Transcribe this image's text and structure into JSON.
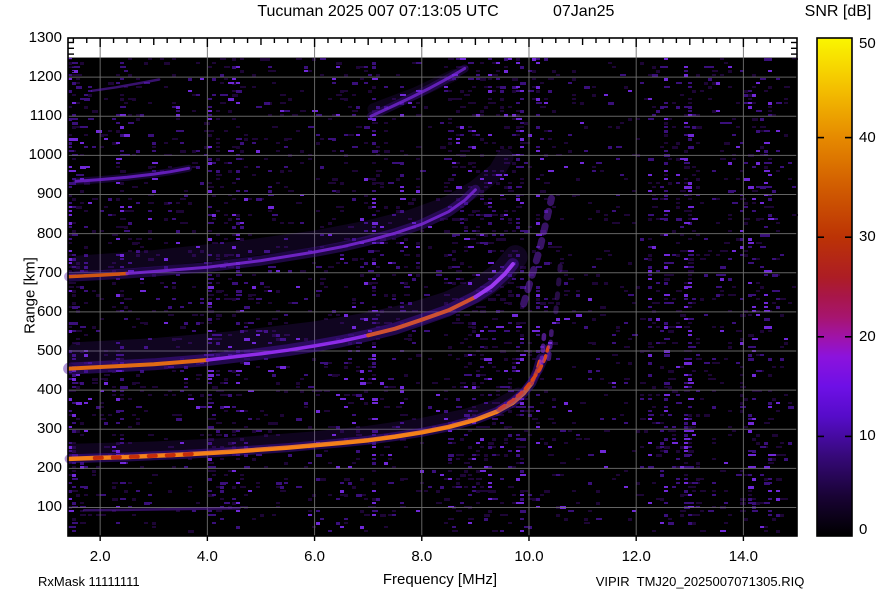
{
  "header": {
    "title_left": "Tucuman 2025 007 07:13:05 UTC",
    "title_right": "07Jan25",
    "colorbar_title": "SNR [dB]"
  },
  "footer": {
    "left": "RxMask 11111111",
    "right": "VIPIR  TMJ20_2025007071305.RIQ"
  },
  "axes": {
    "x": {
      "label": "Frequency [MHz]",
      "range_mhz": [
        1.4,
        15.0
      ],
      "tick_values": [
        2,
        4,
        6,
        8,
        10,
        12,
        14
      ],
      "tick_labels": [
        "2.0",
        "4.0",
        "6.0",
        "8.0",
        "10.0",
        "12.0",
        "14.0"
      ],
      "minor_step_mhz": 0.25
    },
    "y": {
      "label": "Range [km]",
      "range_km": [
        27,
        1300
      ],
      "tick_values": [
        100,
        200,
        300,
        400,
        500,
        600,
        700,
        800,
        900,
        1000,
        1100,
        1200,
        1300
      ],
      "tick_labels": [
        "100",
        "200",
        "300",
        "400",
        "500",
        "600",
        "700",
        "800",
        "900",
        "1000",
        "1100",
        "1200",
        "1300"
      ]
    },
    "colorbar": {
      "label": "SNR [dB]",
      "range_db": [
        0,
        50
      ],
      "tick_values": [
        0,
        10,
        20,
        30,
        40,
        50
      ],
      "tick_labels": [
        "0",
        "10",
        "20",
        "30",
        "40",
        "50"
      ],
      "gradient": [
        [
          0,
          "#000000"
        ],
        [
          0.08,
          "#190335"
        ],
        [
          0.16,
          "#360979"
        ],
        [
          0.24,
          "#560cc9"
        ],
        [
          0.3,
          "#6e10e6"
        ],
        [
          0.36,
          "#8c13dd"
        ],
        [
          0.4,
          "#a013a8"
        ],
        [
          0.44,
          "#a7156e"
        ],
        [
          0.48,
          "#a8164a"
        ],
        [
          0.52,
          "#ad1d24"
        ],
        [
          0.6,
          "#bc3305"
        ],
        [
          0.7,
          "#d15c01"
        ],
        [
          0.8,
          "#e68a00"
        ],
        [
          0.9,
          "#f4c000"
        ],
        [
          1.0,
          "#faf600"
        ]
      ]
    }
  },
  "chart_data": {
    "type": "heatmap",
    "title": "Tucuman ionogram 2025 day 007 07:13:05 UTC",
    "xlabel": "Frequency [MHz]",
    "ylabel": "Range [km]",
    "xlim_mhz": [
      1.4,
      15.0
    ],
    "ylim_km": [
      27,
      1300
    ],
    "snr_scale_db": [
      0,
      50
    ],
    "data_max_range_km": 1250,
    "grid": {
      "color": "#6f6f6f",
      "x_every_mhz": 2,
      "y_every_km": 100
    },
    "background_color": "#000000",
    "noise_speckle": {
      "base_density": 0.11,
      "colors": {
        "dim": "#220640",
        "mid": "#42118c",
        "bright": "#7c2cf0"
      },
      "low_range_sparse_below_km": 78
    },
    "rfi_stripes": [
      {
        "f": 1.48,
        "hw": 0.08,
        "boost": 5.0
      },
      {
        "f": 2.38,
        "hw": 0.05,
        "boost": 3.0
      },
      {
        "f": 4.06,
        "hw": 0.06,
        "boost": 5.0
      },
      {
        "f": 4.55,
        "hw": 0.05,
        "boost": 3.0
      },
      {
        "f": 7.12,
        "hw": 0.06,
        "boost": 5.0
      },
      {
        "f": 7.6,
        "hw": 0.04,
        "boost": 2.5
      },
      {
        "f": 9.25,
        "hw": 0.05,
        "boost": 3.0
      },
      {
        "f": 9.85,
        "hw": 0.06,
        "boost": 3.5
      },
      {
        "f": 10.15,
        "hw": 0.05,
        "boost": 3.0
      },
      {
        "f": 12.25,
        "hw": 0.04,
        "boost": 2.5
      },
      {
        "f": 12.55,
        "hw": 0.06,
        "boost": 3.5
      },
      {
        "f": 12.98,
        "hw": 0.07,
        "boost": 4.5
      },
      {
        "f": 14.15,
        "hw": 0.06,
        "boost": 2.5
      },
      {
        "f": 14.45,
        "hw": 0.06,
        "boost": 2.5
      }
    ],
    "noise_bands": [
      {
        "f0": 1.42,
        "f1": 1.8,
        "mult": 2.2
      },
      {
        "f0": 2.2,
        "f1": 2.6,
        "mult": 1.5
      },
      {
        "f0": 4.0,
        "f1": 4.75,
        "mult": 1.9
      },
      {
        "f0": 6.85,
        "f1": 7.35,
        "mult": 1.6
      },
      {
        "f0": 7.9,
        "f1": 9.9,
        "mult": 2.1
      },
      {
        "f0": 10.55,
        "f1": 12.2,
        "mult": 0.7
      },
      {
        "f0": 12.35,
        "f1": 13.2,
        "mult": 1.45
      },
      {
        "f0": 13.95,
        "f1": 14.65,
        "mult": 1.6
      },
      {
        "f0": 14.7,
        "f1": 15.0,
        "mult": 0.6
      }
    ],
    "dropout_bands": [
      {
        "f0": 3.02,
        "f1": 3.22,
        "mult": 0.25
      },
      {
        "f0": 5.55,
        "f1": 5.72,
        "mult": 0.4
      },
      {
        "f0": 8.0,
        "f1": 8.38,
        "mult": 0.2
      }
    ],
    "series": [
      {
        "name": "F2-trace-1hop-O",
        "style": "trace",
        "halo": {
          "color": "#4a12a8",
          "width": 9,
          "opacity": 0.45
        },
        "segments": [
          {
            "f0": 1.42,
            "f1": 10.05,
            "color": "#f58218",
            "width": 4.5
          },
          {
            "f0": 10.05,
            "f1": 10.22,
            "color": "#e84e14",
            "width": 4,
            "dash": "5 4"
          }
        ],
        "points": [
          [
            1.42,
            224
          ],
          [
            2,
            227
          ],
          [
            2.5,
            229
          ],
          [
            3,
            232
          ],
          [
            3.5,
            235
          ],
          [
            4,
            239
          ],
          [
            4.5,
            243
          ],
          [
            5,
            248
          ],
          [
            5.5,
            253
          ],
          [
            6,
            259
          ],
          [
            6.5,
            265
          ],
          [
            7,
            272
          ],
          [
            7.5,
            281
          ],
          [
            8,
            292
          ],
          [
            8.5,
            306
          ],
          [
            9,
            324
          ],
          [
            9.4,
            345
          ],
          [
            9.7,
            368
          ],
          [
            9.9,
            392
          ],
          [
            10.05,
            418
          ],
          [
            10.15,
            448
          ],
          [
            10.22,
            482
          ]
        ]
      },
      {
        "name": "F2-trace-1hop-O-red-patches",
        "style": "dashes",
        "color": "#c22807",
        "width": 4,
        "opacity": 0.95,
        "dash": "7 11",
        "points": [
          [
            1.9,
            226.5
          ],
          [
            2.6,
            229.5
          ],
          [
            3.3,
            233.5
          ],
          [
            3.8,
            237
          ]
        ]
      },
      {
        "name": "F2-trace-1hop-X",
        "style": "trace",
        "halo": {
          "color": "#4a12a8",
          "width": 7,
          "opacity": 0.35
        },
        "segments": [
          {
            "f0": 9.45,
            "f1": 10.36,
            "color": "#d8451a",
            "width": 3.5,
            "dash": "6 5"
          }
        ],
        "points": [
          [
            9.45,
            352
          ],
          [
            9.7,
            374
          ],
          [
            9.9,
            398
          ],
          [
            10.05,
            424
          ],
          [
            10.2,
            452
          ],
          [
            10.3,
            482
          ],
          [
            10.36,
            510
          ]
        ]
      },
      {
        "name": "F2-cusp-top-spread-O",
        "style": "dashes",
        "color": "#8a30f0",
        "width": 4.5,
        "opacity": 0.55,
        "dash": "5 7",
        "points": [
          [
            10.23,
            470
          ],
          [
            10.26,
            505
          ],
          [
            10.28,
            540
          ]
        ]
      },
      {
        "name": "F2-cusp-top-spread-X",
        "style": "dashes",
        "color": "#8a30f0",
        "width": 4.5,
        "opacity": 0.45,
        "dash": "5 7",
        "points": [
          [
            10.37,
            480
          ],
          [
            10.4,
            515
          ],
          [
            10.42,
            550
          ]
        ]
      },
      {
        "name": "F2-trace-2hop",
        "style": "trace",
        "halo": {
          "color": "#4a12a8",
          "width": 12,
          "opacity": 0.45
        },
        "segments": [
          {
            "f0": 1.42,
            "f1": 4.0,
            "color": "#e06a14",
            "width": 4
          },
          {
            "f0": 4.0,
            "f1": 7.0,
            "color": "#8f2ce8",
            "width": 3.5
          },
          {
            "f0": 7.0,
            "f1": 9.0,
            "color": "#e05a16",
            "width": 4
          },
          {
            "f0": 9.0,
            "f1": 9.7,
            "color": "#a43cf5",
            "width": 4
          }
        ],
        "points": [
          [
            1.42,
            455
          ],
          [
            2,
            459
          ],
          [
            3,
            466
          ],
          [
            4,
            477
          ],
          [
            5,
            493
          ],
          [
            5.5,
            502
          ],
          [
            6,
            513
          ],
          [
            6.5,
            525
          ],
          [
            7,
            540
          ],
          [
            7.5,
            557
          ],
          [
            8,
            580
          ],
          [
            8.5,
            604
          ],
          [
            9,
            638
          ],
          [
            9.3,
            665
          ],
          [
            9.55,
            697
          ],
          [
            9.7,
            722
          ]
        ]
      },
      {
        "name": "F2-2hop-cusp-spread",
        "style": "dashes",
        "color": "#7d2ae0",
        "width": 7,
        "opacity": 0.45,
        "dash": "6 9",
        "points": [
          [
            9.9,
            620
          ],
          [
            10.05,
            690
          ],
          [
            10.2,
            760
          ],
          [
            10.32,
            830
          ],
          [
            10.42,
            890
          ]
        ]
      },
      {
        "name": "F2-2hop-cusp-spread-2",
        "style": "dashes",
        "color": "#7d2ae0",
        "width": 5,
        "opacity": 0.3,
        "dash": "4 10",
        "points": [
          [
            10.5,
            600
          ],
          [
            10.55,
            670
          ],
          [
            10.6,
            740
          ]
        ]
      },
      {
        "name": "F2-trace-3hop",
        "style": "trace",
        "halo": {
          "color": "#4a12a8",
          "width": 10,
          "opacity": 0.4
        },
        "segments": [
          {
            "f0": 1.42,
            "f1": 2.5,
            "color": "#cf5512",
            "width": 3.5
          },
          {
            "f0": 2.5,
            "f1": 9.0,
            "color": "#7b28d8",
            "width": 3,
            "opacity": 0.85
          }
        ],
        "points": [
          [
            1.42,
            690
          ],
          [
            2,
            694
          ],
          [
            2.5,
            698
          ],
          [
            3,
            703
          ],
          [
            4,
            714
          ],
          [
            5,
            731
          ],
          [
            6,
            753
          ],
          [
            6.5,
            766
          ],
          [
            7,
            782
          ],
          [
            7.5,
            801
          ],
          [
            8,
            824
          ],
          [
            8.5,
            856
          ],
          [
            8.8,
            885
          ],
          [
            9.0,
            912
          ]
        ]
      },
      {
        "name": "F2-trace-4hop-flat",
        "style": "trace",
        "halo": {
          "color": "#4a12a8",
          "width": 7,
          "opacity": 0.3
        },
        "segments": [
          {
            "f0": 1.55,
            "f1": 3.65,
            "color": "#6f22cc",
            "width": 3,
            "opacity": 0.85
          }
        ],
        "points": [
          [
            1.55,
            934
          ],
          [
            2,
            938
          ],
          [
            2.5,
            944
          ],
          [
            3,
            952
          ],
          [
            3.3,
            958
          ],
          [
            3.65,
            967
          ]
        ]
      },
      {
        "name": "F2-trace-4hop-rise",
        "style": "trace",
        "halo": {
          "color": "#4a12a8",
          "width": 8,
          "opacity": 0.3
        },
        "segments": [
          {
            "f0": 7.05,
            "f1": 8.8,
            "color": "#7b2ade",
            "width": 3,
            "opacity": 0.75
          }
        ],
        "points": [
          [
            7.05,
            1100
          ],
          [
            7.4,
            1122
          ],
          [
            7.8,
            1148
          ],
          [
            8.15,
            1172
          ],
          [
            8.5,
            1198
          ],
          [
            8.8,
            1222
          ]
        ]
      },
      {
        "name": "F2-trace-5hop-flat",
        "style": "trace",
        "segments": [
          {
            "f0": 1.85,
            "f1": 3.1,
            "color": "#5e1db8",
            "width": 2.5,
            "opacity": 0.6
          }
        ],
        "points": [
          [
            1.85,
            1165
          ],
          [
            2.3,
            1174
          ],
          [
            2.75,
            1185
          ],
          [
            3.1,
            1194
          ]
        ]
      },
      {
        "name": "E-region-faint",
        "style": "trace",
        "segments": [
          {
            "f0": 1.7,
            "f1": 4.6,
            "color": "#5c1bb0",
            "width": 2.5,
            "opacity": 0.55
          }
        ],
        "points": [
          [
            1.7,
            93
          ],
          [
            2.6,
            94
          ],
          [
            3.6,
            96
          ],
          [
            4.6,
            98
          ]
        ]
      },
      {
        "name": "spread-above-1hop",
        "style": "cloud",
        "color": "#6a1fd8",
        "width": 13,
        "opacity": 0.14,
        "points": [
          [
            1.5,
            246
          ],
          [
            3,
            252
          ],
          [
            4.5,
            262
          ],
          [
            6,
            278
          ],
          [
            7,
            292
          ],
          [
            8,
            312
          ],
          [
            8.8,
            335
          ],
          [
            9.4,
            360
          ],
          [
            9.8,
            390
          ]
        ]
      },
      {
        "name": "spread-above-2hop",
        "style": "cloud",
        "color": "#6a1fd8",
        "width": 24,
        "opacity": 0.15,
        "points": [
          [
            1.6,
            492
          ],
          [
            3,
            502
          ],
          [
            4.5,
            520
          ],
          [
            6,
            545
          ],
          [
            7,
            568
          ],
          [
            7.8,
            592
          ],
          [
            8.5,
            622
          ],
          [
            9.1,
            660
          ],
          [
            9.5,
            700
          ],
          [
            9.75,
            740
          ]
        ]
      },
      {
        "name": "spread-above-3hop",
        "style": "cloud",
        "color": "#6a1fd8",
        "width": 17,
        "opacity": 0.13,
        "points": [
          [
            1.6,
            722
          ],
          [
            3,
            736
          ],
          [
            4.5,
            758
          ],
          [
            6,
            786
          ],
          [
            7,
            812
          ],
          [
            7.8,
            840
          ],
          [
            8.5,
            875
          ],
          [
            9.0,
            915
          ],
          [
            9.4,
            960
          ],
          [
            9.55,
            995
          ]
        ]
      },
      {
        "name": "spread-above-4hop-rise",
        "style": "cloud",
        "color": "#6a1fd8",
        "width": 12,
        "opacity": 0.12,
        "points": [
          [
            7.1,
            1118
          ],
          [
            7.9,
            1160
          ],
          [
            8.6,
            1205
          ]
        ]
      }
    ]
  }
}
